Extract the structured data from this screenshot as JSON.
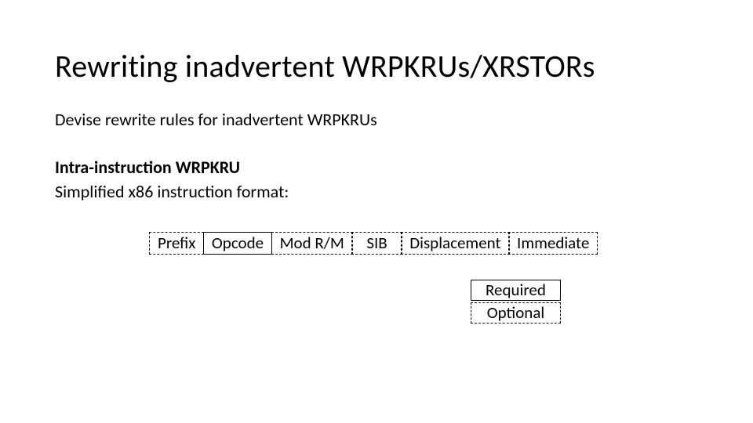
{
  "title": "Rewriting inadvertent WRPKRUs/XRSTORs",
  "lead": "Devise rewrite rules for inadvertent WRPKRUs",
  "subheading": "Intra-instruction WRPKRU",
  "format_caption": "Simplified x86 instruction format:",
  "fields": {
    "prefix": "Prefix",
    "opcode": "Opcode",
    "modrm": "Mod R/M",
    "sib": "SIB",
    "displacement": "Displacement",
    "immediate": "Immediate"
  },
  "legend": {
    "required": "Required",
    "optional": "Optional"
  }
}
